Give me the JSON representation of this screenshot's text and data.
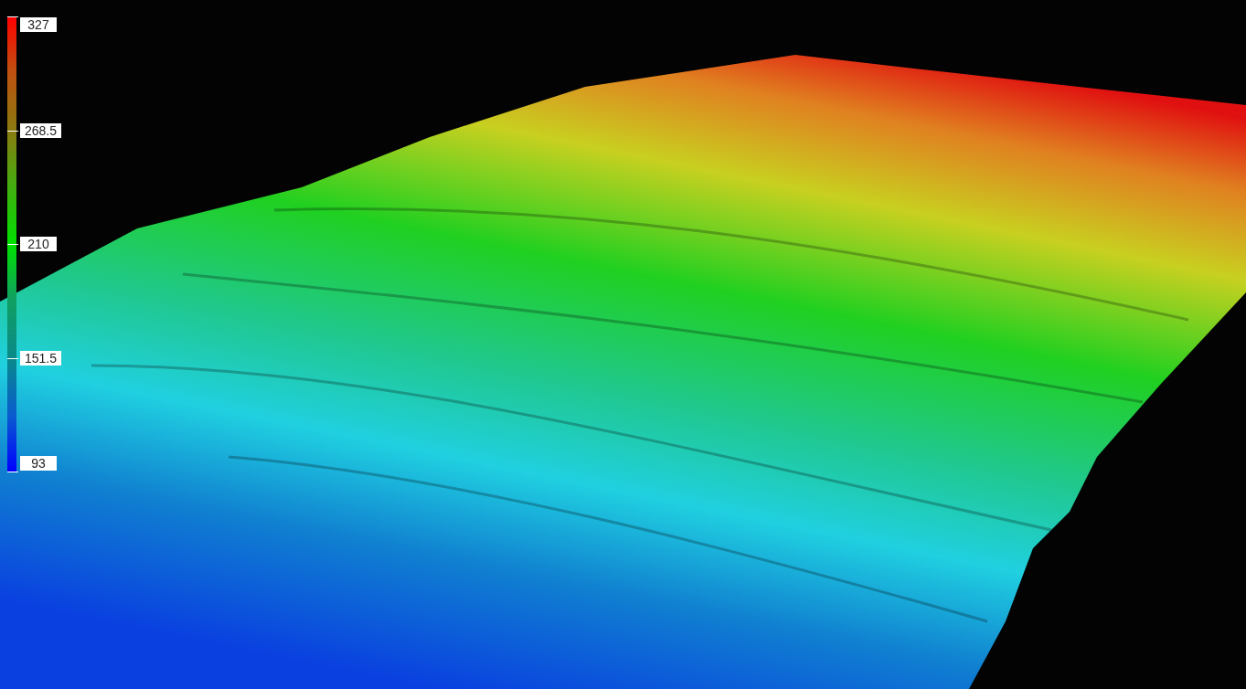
{
  "color_scale": {
    "labels": [
      "327",
      "268.5",
      "210",
      "151.5",
      "93"
    ]
  }
}
